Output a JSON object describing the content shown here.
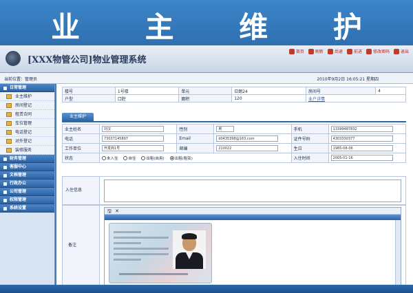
{
  "banner": {
    "title": "业 主 维 护"
  },
  "app": {
    "title": "[XXX物管公司]物业管理系统",
    "top_links": [
      "首页",
      "刷新",
      "后退",
      "前进",
      "修改密码",
      "退出"
    ]
  },
  "crumbbar": {
    "path": "当前位置：管理员",
    "datetime": "2010年9月2日 16:05:21 星期四"
  },
  "sidebar": {
    "groups": [
      {
        "label": "日常管理",
        "items": [
          "业主维护",
          "房间登记",
          "租赁合同",
          "车位管理",
          "电话登记",
          "对外登记",
          "装修服务"
        ]
      },
      {
        "label": "财务管理"
      },
      {
        "label": "客服中心"
      },
      {
        "label": "文档管理"
      },
      {
        "label": "行政办公"
      },
      {
        "label": "公司管理"
      },
      {
        "label": "权限管理"
      },
      {
        "label": "系统设置"
      }
    ]
  },
  "info": {
    "row1": [
      "楼号",
      "1号楼",
      "单元",
      "日朗24",
      "房间号",
      "4"
    ],
    "row2": [
      "户型",
      "口腔",
      "面积",
      "120",
      "业户详情"
    ]
  },
  "tab": {
    "label": "业主维护"
  },
  "form": {
    "name_label": "业主姓名",
    "name_value": "刘汉",
    "gender_label": "性别",
    "gender_value": "男",
    "mobile_label": "手机",
    "mobile_value": "13399487832",
    "phone_label": "电话",
    "phone_value": "73037145897",
    "email_label": "Email",
    "email_value": "d0435398@163.com",
    "id_label": "证件号码",
    "id_value": "4303330377",
    "unit_label": "工作单位",
    "unit_value": "开发商1号",
    "zip_label": "邮编",
    "zip_value": "210022",
    "birth_label": "生日",
    "birth_value": "1985-08-06",
    "status_label": "状态",
    "status_options": [
      "未入住",
      "自住",
      "出租(自用)",
      "出租(租赁)"
    ],
    "status_selected": 3,
    "checkin_label": "入住时间",
    "checkin_value": "2005-01-16",
    "remark_label": "入住信息",
    "note_label": "备注",
    "toolbar": [
      "save-icon",
      "close-icon"
    ]
  },
  "colors": {
    "banner": "#3d86c9",
    "sidebar_group": "#2c63a4",
    "tab": "#2d64a6"
  }
}
